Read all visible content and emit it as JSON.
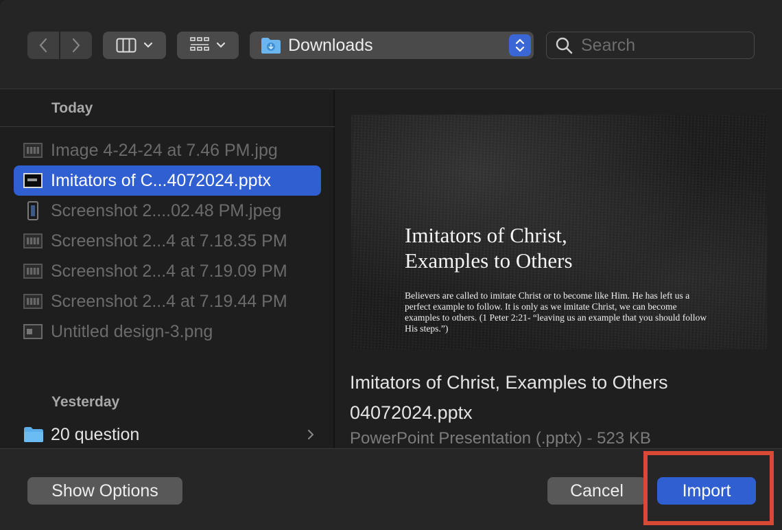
{
  "toolbar": {
    "location": "Downloads",
    "search_placeholder": "Search"
  },
  "list": {
    "sections": [
      {
        "header": "Today",
        "items": [
          {
            "name": "Image 4-24-24 at 7.46 PM.jpg",
            "icon": "image-thumbnail-icon",
            "state": "dimmed"
          },
          {
            "name": "Imitators of C...4072024.pptx",
            "icon": "pptx-thumbnail-icon",
            "state": "selected"
          },
          {
            "name": "Screenshot 2....02.48 PM.jpeg",
            "icon": "phone-screenshot-icon",
            "state": "dimmed"
          },
          {
            "name": "Screenshot 2...4 at 7.18.35 PM",
            "icon": "screenshot-thumbnail-icon",
            "state": "dimmed"
          },
          {
            "name": "Screenshot 2...4 at 7.19.09 PM",
            "icon": "screenshot-thumbnail-icon",
            "state": "dimmed"
          },
          {
            "name": "Screenshot 2...4 at 7.19.44 PM",
            "icon": "screenshot-thumbnail-icon",
            "state": "dimmed"
          },
          {
            "name": "Untitled design-3.png",
            "icon": "design-thumbnail-icon",
            "state": "dimmed"
          }
        ]
      },
      {
        "header": "Yesterday",
        "items": [
          {
            "name": "20 question",
            "icon": "folder-icon",
            "state": "folder"
          }
        ]
      }
    ]
  },
  "preview": {
    "slide_title": "Imitators of Christ,\nExamples to Others",
    "slide_body": "Believers are called to imitate Christ or to become like Him. He has left us a perfect example to follow. It is only as we imitate Christ, we can become examples to others. (1 Peter 2:21- “leaving us an example that you should follow His steps.”)",
    "file_name": "Imitators of Christ, Examples to Others 04072024.pptx",
    "file_meta": "PowerPoint Presentation (.pptx) - 523 KB"
  },
  "footer": {
    "show_options": "Show Options",
    "cancel": "Cancel",
    "import": "Import"
  },
  "colors": {
    "accent": "#2f5fd0",
    "highlight": "#d94a35",
    "background": "#1f1f1f"
  }
}
